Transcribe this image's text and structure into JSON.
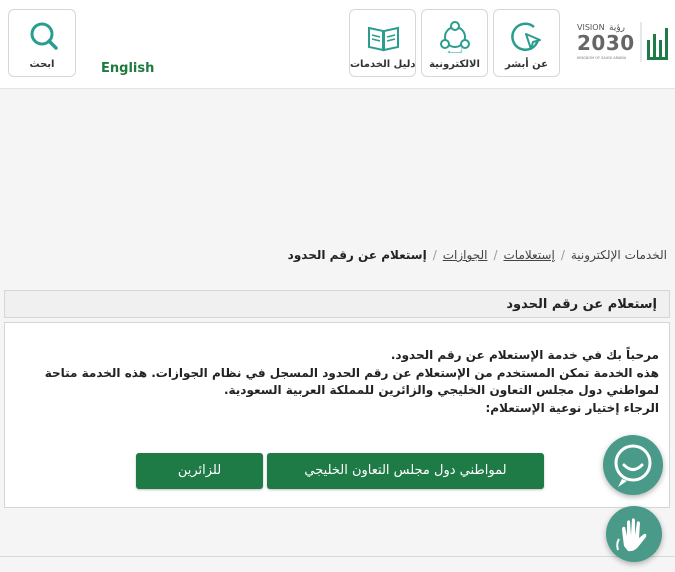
{
  "header": {
    "search_label": "ابحث",
    "language_label": "English",
    "tiles": {
      "absher": "عن أبشر",
      "eservices": "الالكترونية",
      "guide": "دليل الخدمات"
    },
    "logo": {
      "vision_text": "VISION",
      "vision_arabic": "رؤية",
      "vision_year": "2030",
      "kingdom_text": "KINGDOM OF SAUDI ARABIA"
    }
  },
  "breadcrumb": {
    "items": [
      "الخدمات الإلكترونية",
      "إستعلامات",
      "الجوازات"
    ],
    "current": "إستعلام عن رقم الحدود"
  },
  "panel": {
    "title": "إستعلام عن رقم الحدود",
    "message_lines": [
      "مرحباً بك في خدمة الإستعلام عن رقم الحدود.",
      "هذه الخدمة تمكن المستخدم من الإستعلام عن رقم الحدود المسجل في نظام الجوازات. هذه الخدمة متاحة",
      "لمواطني دول مجلس التعاون الخليجي والزائرين للمملكة العربية السعودية.",
      "الرجاء إختيار نوعية الإستعلام:"
    ],
    "buttons": {
      "gcc": "لمواطني دول مجلس التعاون الخليجي",
      "visitors": "للزائرين"
    }
  },
  "colors": {
    "brand_green": "#1e7b45",
    "header_bg": "#ffffff",
    "page_bg": "#f5f5f5",
    "float_teal": "#4a9a8a"
  },
  "icons": [
    "search-icon",
    "absher-pointer-icon",
    "eservices-network-icon",
    "services-guide-book-icon",
    "chat-support-icon",
    "sign-language-icon"
  ]
}
